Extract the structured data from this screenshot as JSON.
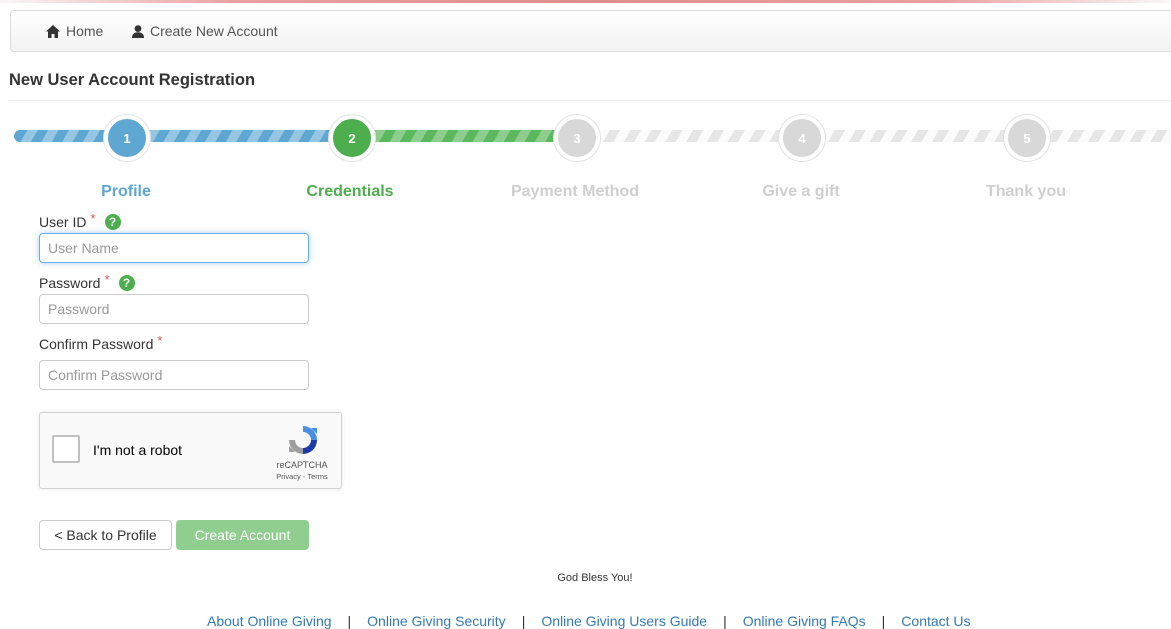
{
  "breadcrumb": {
    "home_label": "Home",
    "create_label": "Create New Account"
  },
  "page_title": "New User Account Registration",
  "steps": [
    {
      "number": "1",
      "label": "Profile",
      "state": "done"
    },
    {
      "number": "2",
      "label": "Credentials",
      "state": "active"
    },
    {
      "number": "3",
      "label": "Payment Method",
      "state": "todo"
    },
    {
      "number": "4",
      "label": "Give a gift",
      "state": "todo"
    },
    {
      "number": "5",
      "label": "Thank you",
      "state": "todo"
    }
  ],
  "form": {
    "user_id": {
      "label": "User ID",
      "required_mark": "*",
      "help_icon": "?",
      "placeholder": "User Name",
      "value": ""
    },
    "password": {
      "label": "Password",
      "required_mark": "*",
      "help_icon": "?",
      "placeholder": "Password",
      "value": ""
    },
    "confirm_password": {
      "label": "Confirm Password",
      "required_mark": "*",
      "placeholder": "Confirm Password",
      "value": ""
    }
  },
  "captcha": {
    "label": "I'm not a robot",
    "brand": "reCAPTCHA",
    "links": "Privacy - Terms",
    "checked": false
  },
  "buttons": {
    "back_label": "< Back to Profile",
    "create_label": "Create Account"
  },
  "blessing": "God Bless You!",
  "footer": {
    "links": [
      "About Online Giving",
      "Online Giving Security",
      "Online Giving Users Guide",
      "Online Giving FAQs",
      "Contact Us"
    ],
    "separator": "|"
  },
  "colors": {
    "done": "#5da7d2",
    "active": "#4cae4c",
    "todo": "#d8d8d8",
    "link": "#337ab7",
    "required": "#d9534f"
  }
}
